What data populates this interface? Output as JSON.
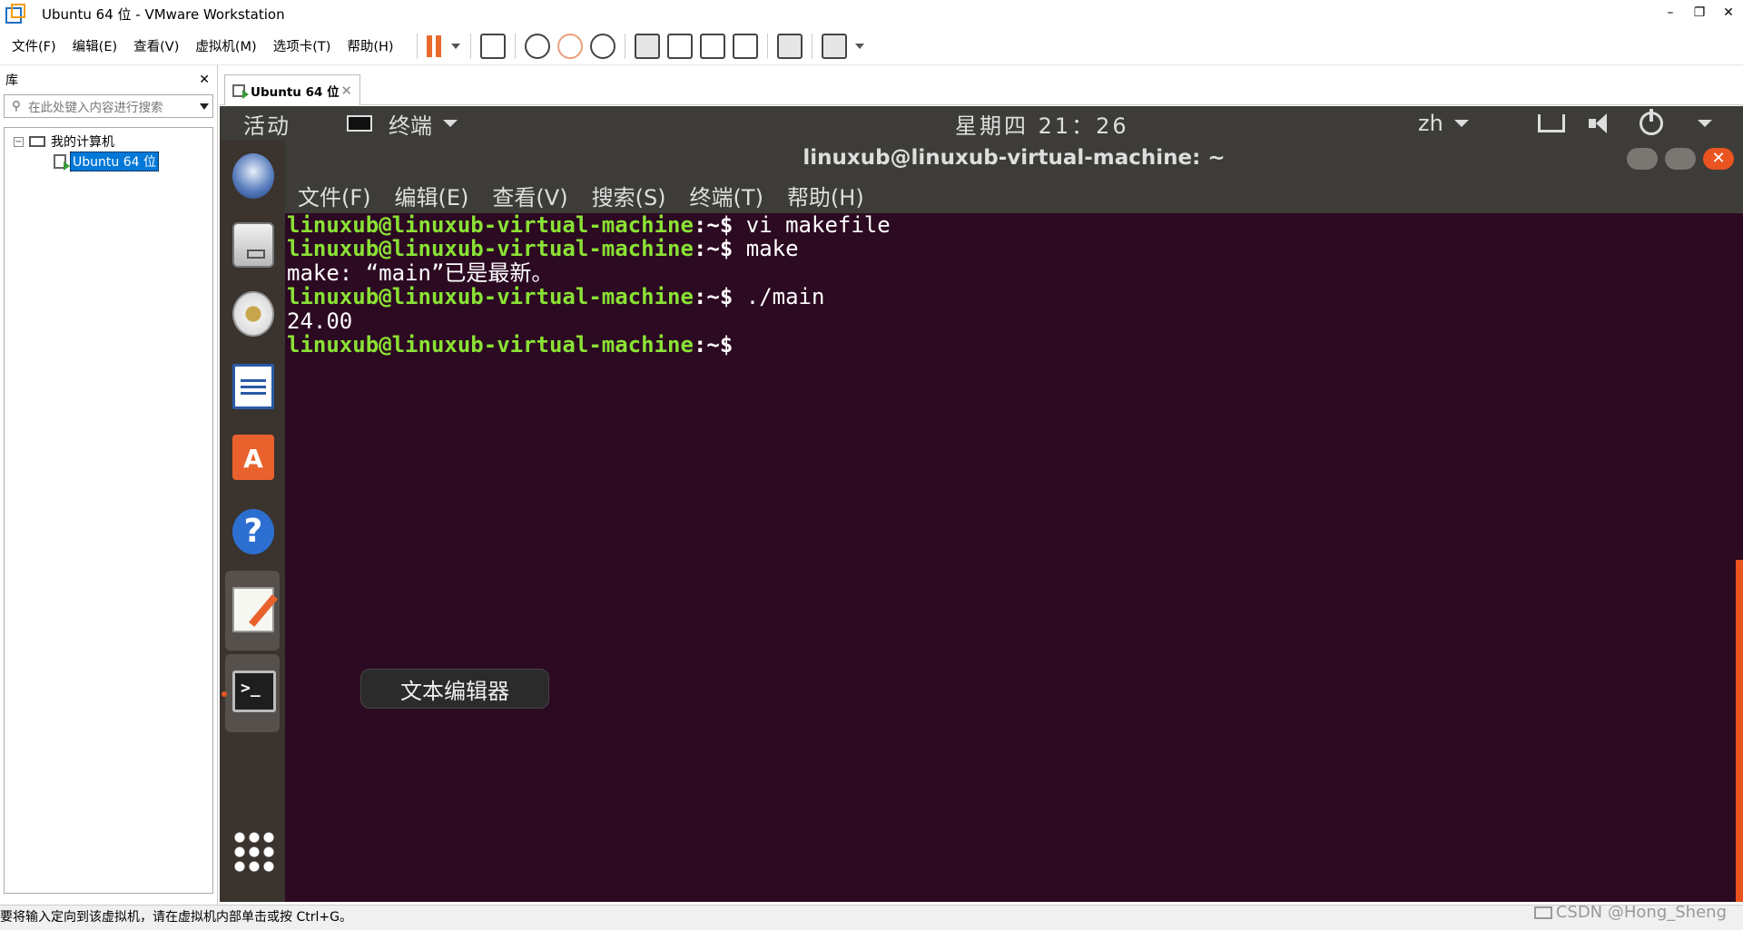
{
  "window": {
    "title": "Ubuntu 64 位 - VMware Workstation",
    "min": "–",
    "restore": "❐",
    "close": "✕"
  },
  "menubar": {
    "items": [
      "文件(F)",
      "编辑(E)",
      "查看(V)",
      "虚拟机(M)",
      "选项卡(T)",
      "帮助(H)"
    ]
  },
  "library": {
    "title": "库",
    "close": "✕",
    "search_placeholder": "在此处键入内容进行搜索",
    "tree": {
      "expander": "−",
      "root": "我的计算机",
      "vm": "Ubuntu 64 位"
    }
  },
  "tab": {
    "label": "Ubuntu 64 位",
    "close": "✕"
  },
  "ubuntu": {
    "activities": "活动",
    "app_name": "终端",
    "clock": "星期四 21：26",
    "lang": "zh",
    "dock_tooltip": "文本编辑器",
    "dock_icons": [
      "thunderbird-icon",
      "files-icon",
      "rhythmbox-icon",
      "libreoffice-writer-icon",
      "software-center-icon",
      "help-icon",
      "text-editor-icon",
      "terminal-icon",
      "show-apps-icon"
    ]
  },
  "terminal": {
    "title": "linuxub@linuxub-virtual-machine: ~",
    "menu": [
      "文件(F)",
      "编辑(E)",
      "查看(V)",
      "搜索(S)",
      "终端(T)",
      "帮助(H)"
    ],
    "prompt": "linuxub@linuxub-virtual-machine",
    "prompt_suffix": ":~$",
    "lines": [
      {
        "type": "cmd",
        "text": " vi makefile"
      },
      {
        "type": "cmd",
        "text": " make"
      },
      {
        "type": "out",
        "text": "make: “main”已是最新。"
      },
      {
        "type": "cmd",
        "text": " ./main"
      },
      {
        "type": "out",
        "text": "24.00"
      },
      {
        "type": "cmd",
        "text": ""
      }
    ]
  },
  "statusbar": {
    "text": "要将输入定向到该虚拟机，请在虚拟机内部单击或按 Ctrl+G。"
  },
  "watermark": {
    "text": "CSDN @Hong_Sheng"
  },
  "colors": {
    "accent": "#e95420",
    "prompt": "#8ae234",
    "terminal_bg": "#2c0a22",
    "topbar": "#3d3c38"
  }
}
